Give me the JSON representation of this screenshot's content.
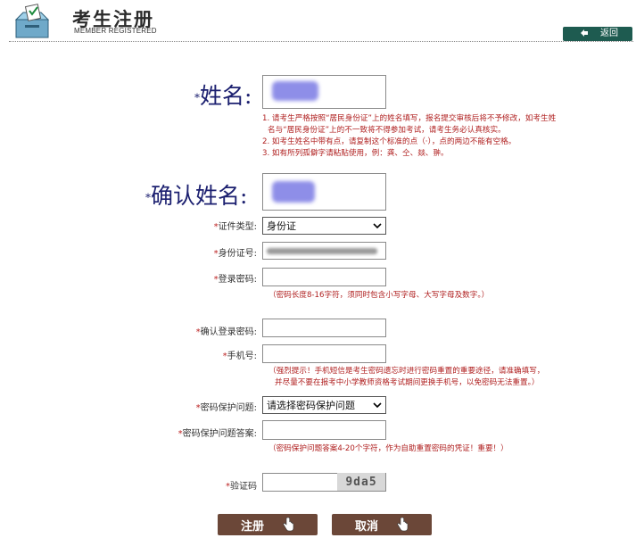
{
  "header": {
    "title": "考生注册",
    "subtitle": "MEMBER REGISTERED",
    "back_label": "返回"
  },
  "form": {
    "name_label": "姓名:",
    "name_notes": [
      "1. 请考生严格按照“居民身份证”上的姓名填写，报名提交审核后将不予修改，如考生姓",
      "名与“居民身份证”上的不一致将不得参加考试，请考生务必认真核实。",
      "2. 如考生姓名中带有点，请复制这个标准的点（·），点的两边不能有空格。",
      "3. 如有所列孤僻字请粘贴使用，例：龚、仝、燚、翀。"
    ],
    "confirm_name_label": "确认姓名:",
    "id_type_label": "证件类型:",
    "id_type_value": "身份证",
    "id_number_label": "身份证号:",
    "login_password_label": "登录密码:",
    "password_hint": "（密码长度8-16字符，须同时包含小写字母、大写字母及数字。）",
    "confirm_password_label": "确认登录密码:",
    "phone_label": "手机号:",
    "phone_hint_line1": "（强烈提示！手机短信是考生密码遗忘时进行密码重置的重要途径，请准确填写，",
    "phone_hint_line2": "并尽量不要在报考中小学教师资格考试期间更换手机号，以免密码无法重置。）",
    "security_question_label": "密码保护问题:",
    "security_question_value": "请选择密码保护问题",
    "security_answer_label": "密码保护问题答案:",
    "answer_hint": "（密码保护问题答案4-20个字符，作为自助重置密码的凭证！重要！）",
    "captcha_label": "验证码",
    "captcha_text": "9da5"
  },
  "buttons": {
    "submit_label": "注册",
    "cancel_label": "取消"
  },
  "colors": {
    "accent_dark_green": "#1e5b50",
    "button_brown": "#6b4738",
    "hint_red": "#b02020",
    "label_navy": "#1c2070"
  },
  "icons": [
    "ballot-box-icon",
    "back-arrow-icon",
    "hand-pointer-icon",
    "chevron-down-icon"
  ]
}
